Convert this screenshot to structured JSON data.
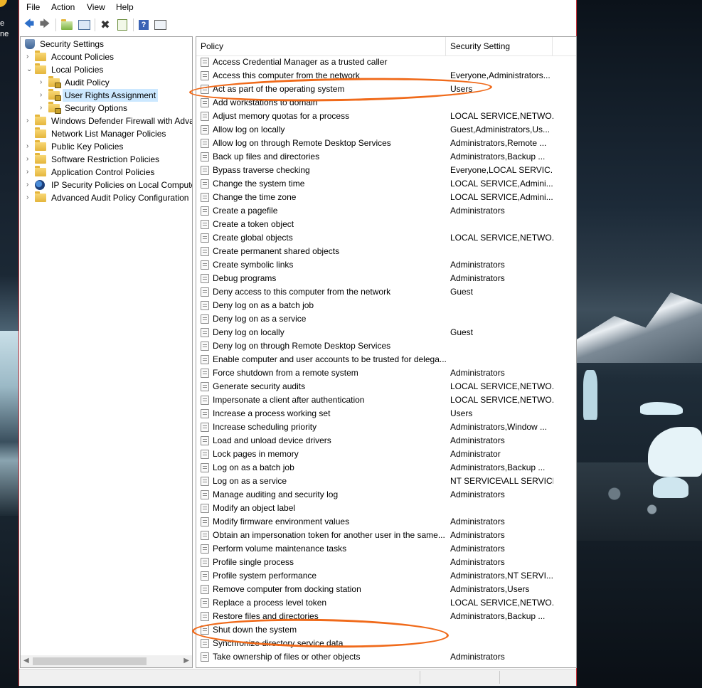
{
  "desktop": {
    "left_text": [
      "e",
      "ne"
    ]
  },
  "menu": [
    "File",
    "Action",
    "View",
    "Help"
  ],
  "toolbar": {
    "buttons": [
      "back-arrow-icon",
      "forward-arrow-icon",
      "up-folder-icon",
      "show-hide-tree-icon",
      "delete-icon",
      "export-list-icon",
      "help-icon",
      "properties-icon"
    ]
  },
  "tree": {
    "root": "Security Settings",
    "items": [
      {
        "label": "Account Policies"
      },
      {
        "label": "Local Policies"
      },
      {
        "label": "Audit Policy"
      },
      {
        "label": "User Rights Assignment"
      },
      {
        "label": "Security Options"
      },
      {
        "label": "Windows Defender Firewall with Adva"
      },
      {
        "label": "Network List Manager Policies"
      },
      {
        "label": "Public Key Policies"
      },
      {
        "label": "Software Restriction Policies"
      },
      {
        "label": "Application Control Policies"
      },
      {
        "label": "IP Security Policies on Local Compute"
      },
      {
        "label": "Advanced Audit Policy Configuration"
      }
    ]
  },
  "list": {
    "columns": {
      "policy": "Policy",
      "setting": "Security Setting"
    },
    "rows": [
      {
        "policy": "Access Credential Manager as a trusted caller",
        "setting": ""
      },
      {
        "policy": "Access this computer from the network",
        "setting": "Everyone,Administrators..."
      },
      {
        "policy": "Act as part of the operating system",
        "setting": "Users"
      },
      {
        "policy": "Add workstations to domain",
        "setting": ""
      },
      {
        "policy": "Adjust memory quotas for a process",
        "setting": "LOCAL SERVICE,NETWO..."
      },
      {
        "policy": "Allow log on locally",
        "setting": "Guest,Administrators,Us..."
      },
      {
        "policy": "Allow log on through Remote Desktop Services",
        "setting": "Administrators,Remote ..."
      },
      {
        "policy": "Back up files and directories",
        "setting": "Administrators,Backup ..."
      },
      {
        "policy": "Bypass traverse checking",
        "setting": "Everyone,LOCAL SERVIC..."
      },
      {
        "policy": "Change the system time",
        "setting": "LOCAL SERVICE,Admini..."
      },
      {
        "policy": "Change the time zone",
        "setting": "LOCAL SERVICE,Admini..."
      },
      {
        "policy": "Create a pagefile",
        "setting": "Administrators"
      },
      {
        "policy": "Create a token object",
        "setting": ""
      },
      {
        "policy": "Create global objects",
        "setting": "LOCAL SERVICE,NETWO..."
      },
      {
        "policy": "Create permanent shared objects",
        "setting": ""
      },
      {
        "policy": "Create symbolic links",
        "setting": "Administrators"
      },
      {
        "policy": "Debug programs",
        "setting": "Administrators"
      },
      {
        "policy": "Deny access to this computer from the network",
        "setting": "Guest"
      },
      {
        "policy": "Deny log on as a batch job",
        "setting": ""
      },
      {
        "policy": "Deny log on as a service",
        "setting": ""
      },
      {
        "policy": "Deny log on locally",
        "setting": "Guest"
      },
      {
        "policy": "Deny log on through Remote Desktop Services",
        "setting": ""
      },
      {
        "policy": "Enable computer and user accounts to be trusted for delega...",
        "setting": ""
      },
      {
        "policy": "Force shutdown from a remote system",
        "setting": "Administrators"
      },
      {
        "policy": "Generate security audits",
        "setting": "LOCAL SERVICE,NETWO..."
      },
      {
        "policy": "Impersonate a client after authentication",
        "setting": "LOCAL SERVICE,NETWO..."
      },
      {
        "policy": "Increase a process working set",
        "setting": "Users"
      },
      {
        "policy": "Increase scheduling priority",
        "setting": "Administrators,Window ..."
      },
      {
        "policy": "Load and unload device drivers",
        "setting": "Administrators"
      },
      {
        "policy": "Lock pages in memory",
        "setting": "Administrator"
      },
      {
        "policy": "Log on as a batch job",
        "setting": "Administrators,Backup ..."
      },
      {
        "policy": "Log on as a service",
        "setting": "NT SERVICE\\ALL SERVICES"
      },
      {
        "policy": "Manage auditing and security log",
        "setting": "Administrators"
      },
      {
        "policy": "Modify an object label",
        "setting": ""
      },
      {
        "policy": "Modify firmware environment values",
        "setting": "Administrators"
      },
      {
        "policy": "Obtain an impersonation token for another user in the same...",
        "setting": "Administrators"
      },
      {
        "policy": "Perform volume maintenance tasks",
        "setting": "Administrators"
      },
      {
        "policy": "Profile single process",
        "setting": "Administrators"
      },
      {
        "policy": "Profile system performance",
        "setting": "Administrators,NT SERVI..."
      },
      {
        "policy": "Remove computer from docking station",
        "setting": "Administrators,Users"
      },
      {
        "policy": "Replace a process level token",
        "setting": "LOCAL SERVICE,NETWO..."
      },
      {
        "policy": "Restore files and directories",
        "setting": "Administrators,Backup ..."
      },
      {
        "policy": "Shut down the system",
        "setting": ""
      },
      {
        "policy": "Synchronize directory service data",
        "setting": ""
      },
      {
        "policy": "Take ownership of files or other objects",
        "setting": "Administrators"
      }
    ]
  },
  "colors": {
    "annotation": "#f06a1a",
    "selection": "#cce8ff",
    "window_border": "#c4323a"
  }
}
